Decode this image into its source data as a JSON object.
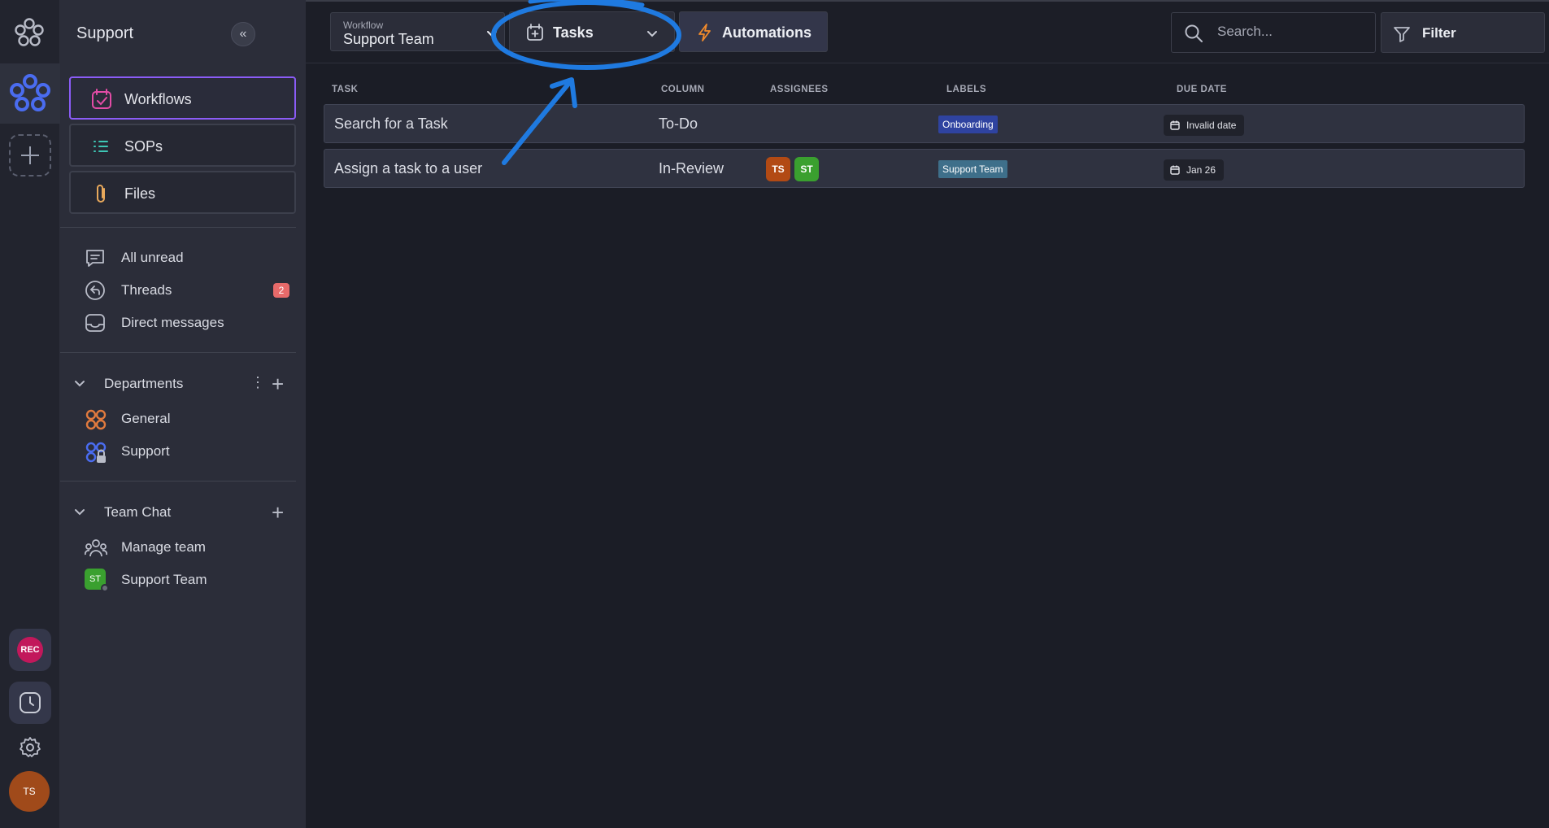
{
  "sidebar": {
    "title": "Support",
    "nav": [
      {
        "label": "Workflows",
        "icon": "calendar-check-icon"
      },
      {
        "label": "SOPs",
        "icon": "list-icon"
      },
      {
        "label": "Files",
        "icon": "paperclip-icon"
      }
    ],
    "inbox": [
      {
        "label": "All unread",
        "icon": "chat-icon"
      },
      {
        "label": "Threads",
        "icon": "reply-icon",
        "badge": "2"
      },
      {
        "label": "Direct messages",
        "icon": "inbox-icon"
      }
    ],
    "departments": {
      "title": "Departments",
      "items": [
        {
          "label": "General",
          "icon": "grid-circles-icon"
        },
        {
          "label": "Support",
          "icon": "grid-lock-icon"
        }
      ]
    },
    "team_chat": {
      "title": "Team Chat",
      "items": [
        {
          "label": "Manage team",
          "icon": "team-icon"
        },
        {
          "label": "Support Team",
          "avatar": "ST"
        }
      ]
    }
  },
  "rail": {
    "rec_label": "REC",
    "avatar_initials": "TS"
  },
  "topbar": {
    "workflow_small": "Workflow",
    "workflow_value": "Support Team",
    "tasks_label": "Tasks",
    "automations_label": "Automations",
    "search_placeholder": "Search...",
    "filter_label": "Filter"
  },
  "table": {
    "headers": [
      "TASK",
      "COLUMN",
      "ASSIGNEES",
      "LABELS",
      "DUE DATE"
    ],
    "rows": [
      {
        "task": "Search for a Task",
        "column": "To-Do",
        "assignees": [],
        "label": "Onboarding",
        "due": "Invalid date"
      },
      {
        "task": "Assign a task to a user",
        "column": "In-Review",
        "assignees": [
          "TS",
          "ST"
        ],
        "label": "Support Team",
        "due": "Jan 26"
      }
    ]
  },
  "colors": {
    "accent_purple": "#8b5cf6",
    "label_onboarding": "#2f43a0",
    "label_support": "#3e6f8a",
    "annotation_blue": "#1f7ae0"
  }
}
